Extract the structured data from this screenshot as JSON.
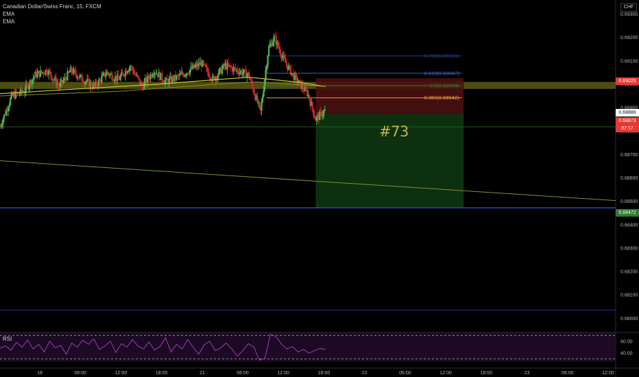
{
  "legend": {
    "title": "Canadian Dollar/Swiss Franc, 15, FXCM",
    "indicator1": "EMA",
    "indicator2": "EMA"
  },
  "currency_label": "CHF",
  "trade_label": "#73",
  "rsi_label": "RSI",
  "price_tags": {
    "stop": "0.69025",
    "last": "0.68886",
    "current": "0.68873",
    "countdown": "07:17",
    "target": "0.68472"
  },
  "colors": {
    "background": "#000000",
    "bull": "#4caf50",
    "bear": "#c62828",
    "ema": "#c9c23a",
    "zone": "#595a12",
    "stop_zone": "#4a0f0f",
    "target_zone": "#0f3a12",
    "blue_line": "#3047b0",
    "rsi_line": "#a33bb3",
    "rsi_bg": "#1c0a24",
    "tag_red": "#e53935",
    "tag_green": "#2e7d32"
  },
  "chart_data": {
    "type": "candlestick",
    "title": "Canadian Dollar/Swiss Franc, 15, FXCM",
    "y_axis": {
      "ticks": [
        "0.69300",
        "0.69200",
        "0.69100",
        "0.69000",
        "0.68900",
        "0.68800",
        "0.68700",
        "0.68600",
        "0.68500",
        "0.68400",
        "0.68300",
        "0.68200",
        "0.68100",
        "0.68000"
      ],
      "range": [
        0.6796,
        0.6936
      ]
    },
    "x_axis": {
      "ticks": [
        "18",
        "06:00",
        "12:00",
        "18:00",
        "21",
        "06:00",
        "12:00",
        "18:00",
        "22",
        "06:00",
        "12:00",
        "18:00",
        "23",
        "06:00",
        "12:00"
      ],
      "range": [
        0,
        15.6
      ]
    },
    "price_path": [
      [
        0,
        0.6882
      ],
      [
        0.3,
        0.6895
      ],
      [
        0.6,
        0.6897
      ],
      [
        0.9,
        0.6904
      ],
      [
        1.2,
        0.6906
      ],
      [
        1.5,
        0.6899
      ],
      [
        1.8,
        0.6906
      ],
      [
        2.1,
        0.6902
      ],
      [
        2.4,
        0.6899
      ],
      [
        2.7,
        0.6905
      ],
      [
        3.0,
        0.6902
      ],
      [
        3.3,
        0.6908
      ],
      [
        3.6,
        0.6899
      ],
      [
        3.9,
        0.6906
      ],
      [
        4.2,
        0.6901
      ],
      [
        4.5,
        0.6903
      ],
      [
        4.8,
        0.6906
      ],
      [
        5.1,
        0.6909
      ],
      [
        5.4,
        0.6902
      ],
      [
        5.7,
        0.6908
      ],
      [
        6.0,
        0.6906
      ],
      [
        6.3,
        0.6904
      ],
      [
        6.6,
        0.6888
      ],
      [
        6.8,
        0.6915
      ],
      [
        6.95,
        0.692
      ],
      [
        7.2,
        0.691
      ],
      [
        7.5,
        0.6902
      ],
      [
        7.8,
        0.6896
      ],
      [
        8.0,
        0.6885
      ],
      [
        8.25,
        0.6889
      ]
    ],
    "ema_fast": [
      [
        0,
        0.6896
      ],
      [
        2.0,
        0.6898
      ],
      [
        4.0,
        0.69
      ],
      [
        5.5,
        0.6902
      ],
      [
        6.3,
        0.6903
      ],
      [
        7.5,
        0.6901
      ],
      [
        8.25,
        0.6899
      ]
    ],
    "ema_slow": [
      [
        0,
        0.6895
      ],
      [
        3.0,
        0.6897
      ],
      [
        5.5,
        0.69
      ],
      [
        6.5,
        0.6901
      ],
      [
        8.25,
        0.6899
      ]
    ],
    "zone": [
      0.6898,
      0.6901
    ],
    "fib_levels": [
      {
        "label": "0.786(0.69121)",
        "value": 0.69121,
        "color": "#2a3a8a"
      },
      {
        "label": "0.618(0.69047)",
        "value": 0.69047,
        "color": "#3f64c8"
      },
      {
        "label": "0.5(0.68994)",
        "value": 0.68994,
        "color": "#2e7d32"
      },
      {
        "label": "0.382(0.68942)",
        "value": 0.68942,
        "color": "#f4a032"
      }
    ],
    "fib_x_range": [
      6.75,
      11.7
    ],
    "stop_level": 0.69025,
    "entry_level": 0.68873,
    "target_level": 0.68472,
    "position_x_range": [
      8.0,
      11.75
    ],
    "horizontal_lines": [
      {
        "value": 0.68818,
        "color": "#1b5e20"
      },
      {
        "value": 0.68472,
        "color": "#3047b0"
      },
      {
        "value": 0.68035,
        "color": "#2a2f86"
      }
    ],
    "trendline": [
      [
        0,
        0.68673
      ],
      [
        15.6,
        0.68503
      ]
    ],
    "rsi": {
      "levels": [
        "60.00",
        "40.00"
      ],
      "upper": 70,
      "lower": 30,
      "values": [
        48,
        52,
        45,
        58,
        50,
        62,
        47,
        55,
        42,
        60,
        49,
        53,
        38,
        57,
        50,
        62,
        55,
        64,
        46,
        52,
        60,
        41,
        56,
        50,
        63,
        52,
        47,
        59,
        45,
        51,
        66,
        42,
        55,
        47,
        63,
        50,
        38,
        54,
        60,
        44,
        49,
        57,
        47,
        35,
        44,
        56,
        50,
        28,
        31,
        72,
        68,
        55,
        47,
        51,
        42,
        46,
        40,
        44,
        48,
        46
      ]
    }
  }
}
